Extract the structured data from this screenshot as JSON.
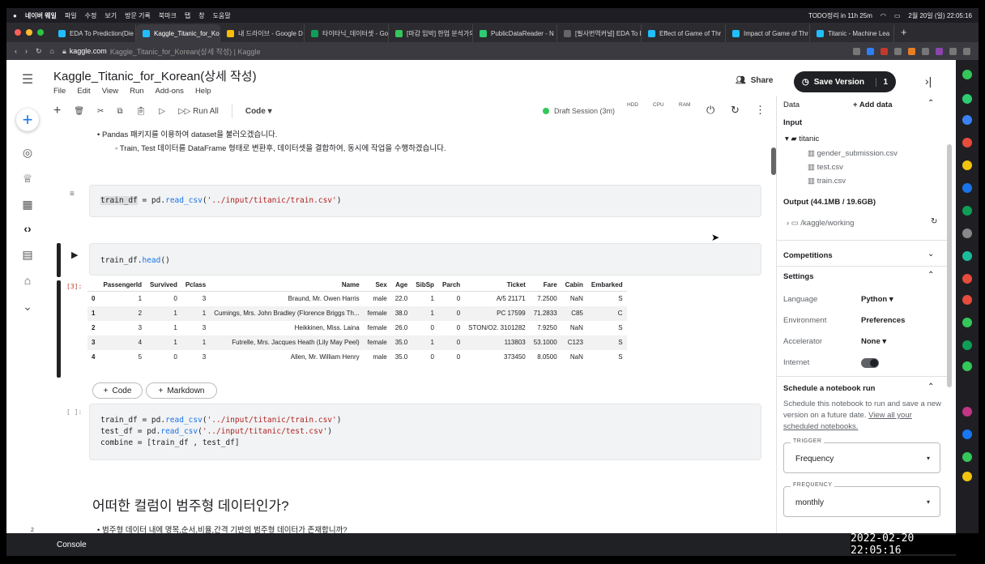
{
  "menubar": {
    "apple": "",
    "app": "네이버 웨일",
    "items": [
      "파일",
      "수정",
      "보기",
      "방문 기록",
      "북마크",
      "탭",
      "창",
      "도움말"
    ],
    "todo": "TODO정리 in 11h 25m",
    "datetime": "2월 20일 (일)  22:05:16"
  },
  "tabs": [
    {
      "label": "EDA To Prediction(Die",
      "fav": "#20beff"
    },
    {
      "label": "Kaggle_Titanic_for_Ko",
      "fav": "#20beff",
      "active": true
    },
    {
      "label": "내 드라이브 - Google D",
      "fav": "#fbbc04"
    },
    {
      "label": "타이타닉_데이터셋 - Go",
      "fav": "#0f9d58"
    },
    {
      "label": "[마감 임박] 한업 분석가의",
      "fav": "#34c759"
    },
    {
      "label": "PublicDataReader - N",
      "fav": "#2ecc71"
    },
    {
      "label": "[필사번역커널] EDA To P",
      "fav": "#666"
    },
    {
      "label": "Effect of Game of Thr",
      "fav": "#20beff"
    },
    {
      "label": "Impact of Game of Thr",
      "fav": "#20beff"
    },
    {
      "label": "Titanic - Machine Lea",
      "fav": "#20beff"
    }
  ],
  "url": {
    "host": "kaggle.com",
    "path": "Kaggle_Titanic_for_Korean(상세 작성) | Kaggle"
  },
  "notebook": {
    "title": "Kaggle_Titanic_for_Korean(상세 작성)",
    "menu": [
      "File",
      "Edit",
      "View",
      "Run",
      "Add-ons",
      "Help"
    ],
    "share": "Share",
    "save_version": "Save Version",
    "version_count": "1",
    "toolbar": {
      "run_all": "Run All",
      "cell_type": "Code",
      "session": "Draft Session (3m)",
      "hdd": "HDD",
      "cpu": "CPU",
      "ram": "RAM"
    }
  },
  "cells": {
    "md1_line1": "Pandas 패키지를 이용하여 dataset을 불러오겠습니다.",
    "md1_line2": "Train, Test 데이터를 DataFrame 형태로 변환후, 데이터셋을 결합하여, 동시에 작업을 수행하겠습니다.",
    "code1": {
      "var": "train_df",
      "eq": " = pd.",
      "fn": "read_csv",
      "open": "(",
      "str": "'../input/titanic/train.csv'",
      "close": ")"
    },
    "code2": {
      "pre": "train_df.",
      "fn": "head",
      "post": "()"
    },
    "prompt3": "[3]:",
    "prompt4": "[ ]:",
    "code4": {
      "l1a": "train_df = pd.",
      "l1fn": "read_csv",
      "l1s": "'../input/titanic/train.csv'",
      "l2a": "test_df = pd.",
      "l2fn": "read_csv",
      "l2s": "'../input/titanic/test.csv'",
      "l3": "combine = [train_df , test_df]"
    },
    "add_code": "Code",
    "add_markdown": "Markdown",
    "heading": "어떠한 컬럼이 범주형 데이터인가?",
    "md2_line1": "범주형 데이터 내에 명목,순서,비율,간격 기반의 범주형 데이터가 존재합니까?"
  },
  "df_table": {
    "columns": [
      "",
      "PassengerId",
      "Survived",
      "Pclass",
      "Name",
      "Sex",
      "Age",
      "SibSp",
      "Parch",
      "Ticket",
      "Fare",
      "Cabin",
      "Embarked"
    ],
    "rows": [
      [
        "0",
        "1",
        "0",
        "3",
        "Braund, Mr. Owen Harris",
        "male",
        "22.0",
        "1",
        "0",
        "A/5 21171",
        "7.2500",
        "NaN",
        "S"
      ],
      [
        "1",
        "2",
        "1",
        "1",
        "Cumings, Mrs. John Bradley (Florence Briggs Th...",
        "female",
        "38.0",
        "1",
        "0",
        "PC 17599",
        "71.2833",
        "C85",
        "C"
      ],
      [
        "2",
        "3",
        "1",
        "3",
        "Heikkinen, Miss. Laina",
        "female",
        "26.0",
        "0",
        "0",
        "STON/O2. 3101282",
        "7.9250",
        "NaN",
        "S"
      ],
      [
        "3",
        "4",
        "1",
        "1",
        "Futrelle, Mrs. Jacques Heath (Lily May Peel)",
        "female",
        "35.0",
        "1",
        "0",
        "113803",
        "53.1000",
        "C123",
        "S"
      ],
      [
        "4",
        "5",
        "0",
        "3",
        "Allen, Mr. William Henry",
        "male",
        "35.0",
        "0",
        "0",
        "373450",
        "8.0500",
        "NaN",
        "S"
      ]
    ]
  },
  "panel": {
    "data": "Data",
    "add_data": "Add data",
    "input": "Input",
    "dataset": "titanic",
    "files": [
      "gender_submission.csv",
      "test.csv",
      "train.csv"
    ],
    "output": "Output (44.1MB / 19.6GB)",
    "working": "/kaggle/working",
    "competitions": "Competitions",
    "settings": "Settings",
    "language_label": "Language",
    "language": "Python",
    "environment_label": "Environment",
    "environment": "Preferences",
    "accelerator_label": "Accelerator",
    "accelerator": "None",
    "internet_label": "Internet",
    "schedule_title": "Schedule a notebook run",
    "schedule_desc": "Schedule this notebook to run and save a new version on a future date.",
    "schedule_link": "View all your scheduled notebooks.",
    "trigger_label": "TRIGGER",
    "trigger": "Frequency",
    "frequency_label": "FREQUENCY",
    "frequency": "monthly"
  },
  "console": "Console",
  "timestamp": "2022-02-20  22:05:16",
  "notif_badge": "2"
}
